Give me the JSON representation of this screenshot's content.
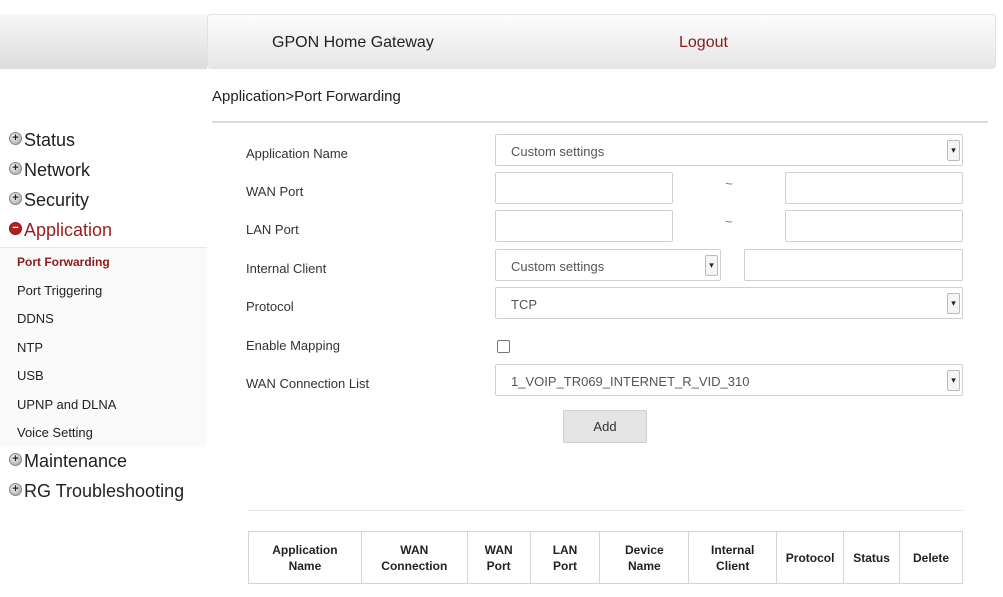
{
  "header": {
    "title": "GPON Home Gateway",
    "logout": "Logout"
  },
  "breadcrumb": "Application>Port Forwarding",
  "sidebar": {
    "top_before": [
      {
        "label": "Status",
        "sign": "+"
      },
      {
        "label": "Network",
        "sign": "+"
      },
      {
        "label": "Security",
        "sign": "+"
      }
    ],
    "open": {
      "label": "Application",
      "sign": "−"
    },
    "sub_items": [
      "Port Forwarding",
      "Port Triggering",
      "DDNS",
      "NTP",
      "USB",
      "UPNP and DLNA",
      "Voice Setting"
    ],
    "active_sub": "Port Forwarding",
    "top_after": [
      {
        "label": "Maintenance",
        "sign": "+"
      },
      {
        "label": "RG Troubleshooting",
        "sign": "+"
      }
    ]
  },
  "form": {
    "application_name": {
      "label": "Application Name",
      "value": "Custom settings"
    },
    "wan_port": {
      "label": "WAN Port",
      "from": "",
      "to": "",
      "separator": "~"
    },
    "lan_port": {
      "label": "LAN Port",
      "from": "",
      "to": "",
      "separator": "~"
    },
    "internal_client": {
      "label": "Internal Client",
      "select_value": "Custom settings",
      "ip": ""
    },
    "protocol": {
      "label": "Protocol",
      "value": "TCP"
    },
    "enable_mapping": {
      "label": "Enable Mapping",
      "checked": false
    },
    "wan_connection_list": {
      "label": "WAN Connection List",
      "value": "1_VOIP_TR069_INTERNET_R_VID_310"
    },
    "add_button": "Add"
  },
  "table": {
    "headers": [
      [
        "Application",
        "Name"
      ],
      [
        "WAN",
        "Connection"
      ],
      [
        "WAN",
        "Port"
      ],
      [
        "LAN",
        "Port"
      ],
      [
        "Device",
        "Name"
      ],
      [
        "Internal",
        "Client"
      ],
      [
        "Protocol"
      ],
      [
        "Status"
      ],
      [
        "Delete"
      ]
    ]
  }
}
